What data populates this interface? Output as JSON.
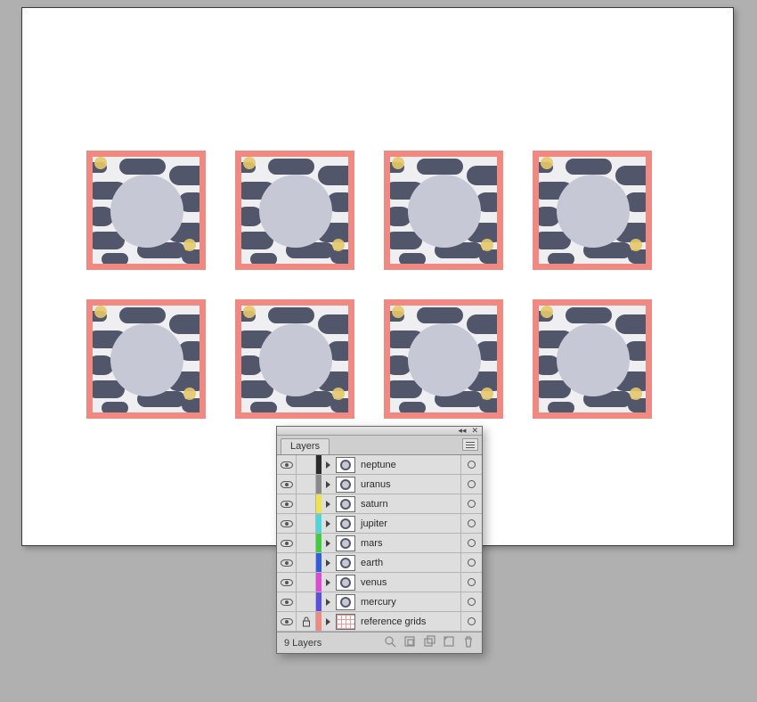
{
  "panel": {
    "tab_label": "Layers",
    "footer_count": "9 Layers"
  },
  "layers": [
    {
      "name": "neptune",
      "color": "#2b2b2b",
      "locked": false,
      "thumb": "planet"
    },
    {
      "name": "uranus",
      "color": "#8a8a8a",
      "locked": false,
      "thumb": "planet"
    },
    {
      "name": "saturn",
      "color": "#f1e24a",
      "locked": false,
      "thumb": "planet"
    },
    {
      "name": "jupiter",
      "color": "#4ad9d9",
      "locked": false,
      "thumb": "planet"
    },
    {
      "name": "mars",
      "color": "#3dcf3d",
      "locked": false,
      "thumb": "planet"
    },
    {
      "name": "earth",
      "color": "#2e5fe0",
      "locked": false,
      "thumb": "planet"
    },
    {
      "name": "venus",
      "color": "#e049d6",
      "locked": false,
      "thumb": "planet"
    },
    {
      "name": "mercury",
      "color": "#5a4fe0",
      "locked": false,
      "thumb": "planet"
    },
    {
      "name": "reference grids",
      "color": "#ef8982",
      "locked": true,
      "thumb": "grid"
    }
  ],
  "footer_icons": [
    "locate-layer-icon",
    "clipping-mask-icon",
    "new-sublayer-icon",
    "new-layer-icon",
    "delete-layer-icon"
  ]
}
